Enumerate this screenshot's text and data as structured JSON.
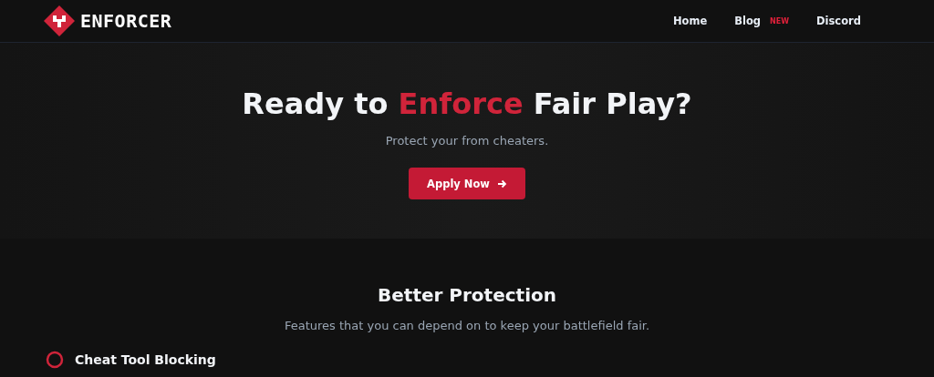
{
  "nav": {
    "brand": "ENFORCER",
    "links": [
      {
        "label": "Home"
      },
      {
        "label": "Blog",
        "badge": "NEW"
      },
      {
        "label": "Discord"
      }
    ]
  },
  "hero": {
    "title_before": "Ready to ",
    "title_accent": "Enforce",
    "title_after": " Fair Play?",
    "subtitle": "Protect your from cheaters.",
    "button": "Apply Now"
  },
  "features": {
    "title": "Better Protection",
    "subtitle": "Features that you can depend on to keep your battlefield fair.",
    "items": [
      {
        "label": "Cheat Tool Blocking"
      }
    ]
  }
}
